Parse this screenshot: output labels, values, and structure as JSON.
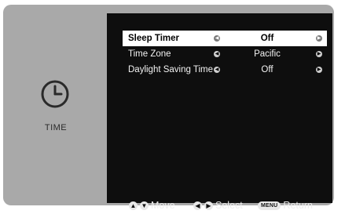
{
  "side": {
    "icon": "clock-icon",
    "label": "TIME"
  },
  "menu": {
    "items": [
      {
        "label": "Sleep Timer",
        "value": "Off",
        "selected": true
      },
      {
        "label": "Time Zone",
        "value": "Pacific",
        "selected": false
      },
      {
        "label": "Daylight Saving Time",
        "value": "Off",
        "selected": false
      }
    ]
  },
  "footer": {
    "move_label": "Move",
    "select_label": "Select",
    "menu_key": "MENU",
    "return_label": "Return"
  },
  "colors": {
    "panel": "#a9a9a9",
    "screen": "#0e0e0e",
    "selected_row": "#ffffff"
  }
}
